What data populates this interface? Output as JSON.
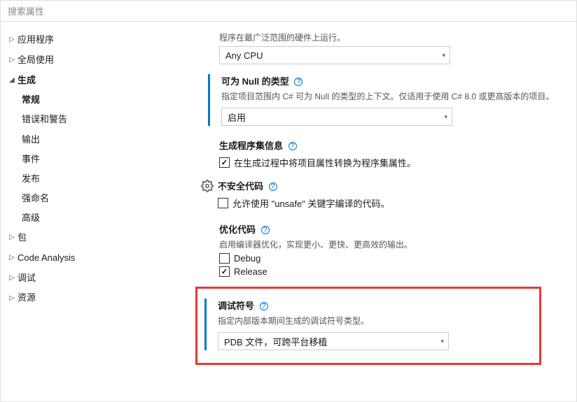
{
  "search": {
    "placeholder": "搜索属性"
  },
  "sidebar": {
    "items": [
      {
        "label": "应用程序",
        "expanded": false
      },
      {
        "label": "全局使用",
        "expanded": false
      },
      {
        "label": "生成",
        "expanded": true,
        "children": [
          {
            "label": "常规",
            "bold": true
          },
          {
            "label": "错误和警告"
          },
          {
            "label": "输出"
          },
          {
            "label": "事件"
          },
          {
            "label": "发布"
          },
          {
            "label": "强命名"
          },
          {
            "label": "高级"
          }
        ]
      },
      {
        "label": "包",
        "expanded": false
      },
      {
        "label": "Code Analysis",
        "expanded": false
      },
      {
        "label": "调试",
        "expanded": false
      },
      {
        "label": "资源",
        "expanded": false
      }
    ]
  },
  "top_desc": "程序在最广泛范围的硬件上运行。",
  "cpu_dropdown": "Any CPU",
  "nullable": {
    "title": "可为 Null 的类型",
    "desc": "指定项目范围内 C# 可为 Null 的类型的上下文。仅适用于使用 C# 8.0 或更高版本的项目。",
    "value": "启用"
  },
  "assembly": {
    "title": "生成程序集信息",
    "checkbox_label": "在生成过程中将项目属性转换为程序集属性。"
  },
  "unsafe": {
    "title": "不安全代码",
    "checkbox_label": "允许使用 \"unsafe\" 关键字编译的代码。"
  },
  "optimize": {
    "title": "优化代码",
    "desc": "启用编译器优化，实现更小、更快、更高效的输出。",
    "debug_label": "Debug",
    "release_label": "Release"
  },
  "debugsym": {
    "title": "调试符号",
    "desc": "指定内部版本期间生成的调试符号类型。",
    "value": "PDB 文件，可跨平台移植"
  }
}
